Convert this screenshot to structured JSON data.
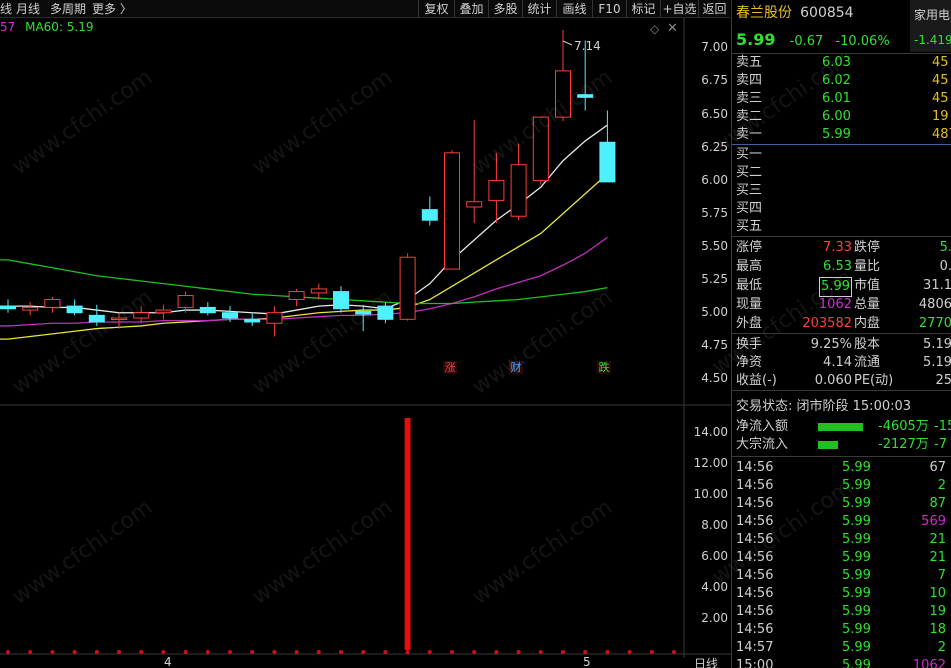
{
  "toolbar": {
    "left": [
      "线",
      "月线",
      "多周期",
      "更多 〉"
    ],
    "buttons": [
      "复权",
      "叠加",
      "多股",
      "统计",
      "画线",
      "F10",
      "标记",
      "+自选",
      "返回"
    ]
  },
  "ma_legend": {
    "prefix": "57",
    "ma60_label": "MA60: 5.19",
    "ma60_color": "#d02ad0"
  },
  "price_axis": [
    "7.00",
    "6.75",
    "6.50",
    "6.25",
    "6.00",
    "5.75",
    "5.50",
    "5.25",
    "5.00",
    "4.75",
    "4.50"
  ],
  "high_annotation": "7.14",
  "events": [
    {
      "label": "涨",
      "color": "#ff4040"
    },
    {
      "label": "财",
      "color": "#4aa8ff"
    },
    {
      "label": "跌",
      "color": "#30e030"
    }
  ],
  "volume_axis": [
    "14.00",
    "12.00",
    "10.00",
    "8.00",
    "6.00",
    "4.00",
    "2.00"
  ],
  "date_axis": [
    "4",
    "5",
    "日线"
  ],
  "colors": {
    "up": "#ff3c3c",
    "down": "#4ff0ff",
    "ma_white": "#e8e8e8",
    "ma_yellow": "#e6e63c",
    "ma_purple": "#c030c0",
    "ma_green": "#20c020",
    "volume_bar": "#e01010",
    "dot": "#d01010"
  },
  "stock": {
    "name": "春兰股份",
    "code": "600854",
    "price": "5.99",
    "change": "-0.67",
    "change_pct": "-10.06%",
    "side_label": "家用电",
    "side_value": "-1.419"
  },
  "order_book": {
    "sell": [
      {
        "label": "卖五",
        "price": "6.03",
        "vol": "45"
      },
      {
        "label": "卖四",
        "price": "6.02",
        "vol": "45"
      },
      {
        "label": "卖三",
        "price": "6.01",
        "vol": "45"
      },
      {
        "label": "卖二",
        "price": "6.00",
        "vol": "19"
      },
      {
        "label": "卖一",
        "price": "5.99",
        "vol": "487"
      }
    ],
    "buy": [
      {
        "label": "买一"
      },
      {
        "label": "买二"
      },
      {
        "label": "买三"
      },
      {
        "label": "买四"
      },
      {
        "label": "买五"
      }
    ]
  },
  "quote_stats": [
    {
      "l1": "涨停",
      "v1": "7.33",
      "c1": "#ff4040",
      "l2": "跌停",
      "v2": "5.",
      "c2": "#30e030"
    },
    {
      "l1": "最高",
      "v1": "6.53",
      "c1": "#30e030",
      "l2": "量比",
      "v2": "0.",
      "c2": "#d0d0d0"
    },
    {
      "l1": "最低",
      "v1": "5.99",
      "c1": "#30e030",
      "l2": "市值",
      "v2": "31.1",
      "c2": "#d0d0d0"
    },
    {
      "l1": "现量",
      "v1": "1062",
      "c1": "#d02ad0",
      "l2": "总量",
      "v2": "4806",
      "c2": "#d0d0d0"
    },
    {
      "l1": "外盘",
      "v1": "203582",
      "c1": "#ff4040",
      "l2": "内盘",
      "v2": "2770",
      "c2": "#30e030"
    }
  ],
  "fundamentals": [
    {
      "l1": "换手",
      "v1": "9.25%",
      "l2": "股本",
      "v2": "5.19"
    },
    {
      "l1": "净资",
      "v1": "4.14",
      "l2": "流通",
      "v2": "5.19"
    },
    {
      "l1": "收益(-)",
      "v1": "0.060",
      "l2": "PE(动)",
      "v2": "25"
    }
  ],
  "trade_status": "交易状态: 闭市阶段 15:00:03",
  "flows": [
    {
      "label": "净流入额",
      "bar_pct": 80,
      "value": "-4605万",
      "extra": "-15"
    },
    {
      "label": "大宗流入",
      "bar_pct": 35,
      "value": "-2127万",
      "extra": "-7"
    }
  ],
  "ticks": [
    {
      "time": "14:56",
      "price": "5.99",
      "vol": "67",
      "vc": "#d0d0d0"
    },
    {
      "time": "14:56",
      "price": "5.99",
      "vol": "2",
      "vc": "#30e030"
    },
    {
      "time": "14:56",
      "price": "5.99",
      "vol": "87",
      "vc": "#30e030"
    },
    {
      "time": "14:56",
      "price": "5.99",
      "vol": "569",
      "vc": "#d02ad0"
    },
    {
      "time": "14:56",
      "price": "5.99",
      "vol": "21",
      "vc": "#30e030"
    },
    {
      "time": "14:56",
      "price": "5.99",
      "vol": "21",
      "vc": "#30e030"
    },
    {
      "time": "14:56",
      "price": "5.99",
      "vol": "7",
      "vc": "#30e030"
    },
    {
      "time": "14:56",
      "price": "5.99",
      "vol": "10",
      "vc": "#30e030"
    },
    {
      "time": "14:56",
      "price": "5.99",
      "vol": "19",
      "vc": "#30e030"
    },
    {
      "time": "14:56",
      "price": "5.99",
      "vol": "18",
      "vc": "#30e030"
    },
    {
      "time": "14:57",
      "price": "5.99",
      "vol": "2",
      "vc": "#30e030"
    },
    {
      "time": "15:00",
      "price": "5.99",
      "vol": "1062",
      "vc": "#d02ad0"
    }
  ],
  "watermark": "www.cfchi.com",
  "chart_data": {
    "type": "candlestick",
    "price_range": [
      4.4,
      7.2
    ],
    "volume_range": [
      0,
      15
    ],
    "candles": [
      {
        "o": 5.05,
        "h": 5.1,
        "l": 5.0,
        "c": 5.03,
        "v": 0.1
      },
      {
        "o": 5.02,
        "h": 5.08,
        "l": 4.98,
        "c": 5.04,
        "v": 0.1
      },
      {
        "o": 5.04,
        "h": 5.12,
        "l": 5.0,
        "c": 5.1,
        "v": 0.1
      },
      {
        "o": 5.05,
        "h": 5.1,
        "l": 4.98,
        "c": 5.0,
        "v": 0.1
      },
      {
        "o": 4.98,
        "h": 5.06,
        "l": 4.9,
        "c": 4.93,
        "v": 0.1
      },
      {
        "o": 4.95,
        "h": 5.0,
        "l": 4.88,
        "c": 4.96,
        "v": 0.1
      },
      {
        "o": 4.96,
        "h": 5.05,
        "l": 4.92,
        "c": 5.0,
        "v": 0.1
      },
      {
        "o": 5.0,
        "h": 5.06,
        "l": 4.95,
        "c": 5.02,
        "v": 0.1
      },
      {
        "o": 5.04,
        "h": 5.16,
        "l": 5.0,
        "c": 5.13,
        "v": 0.1
      },
      {
        "o": 5.04,
        "h": 5.08,
        "l": 4.98,
        "c": 5.0,
        "v": 0.1
      },
      {
        "o": 5.0,
        "h": 5.05,
        "l": 4.93,
        "c": 4.96,
        "v": 0.1
      },
      {
        "o": 4.95,
        "h": 5.0,
        "l": 4.9,
        "c": 4.93,
        "v": 0.1
      },
      {
        "o": 4.92,
        "h": 5.05,
        "l": 4.82,
        "c": 5.0,
        "v": 0.1
      },
      {
        "o": 5.1,
        "h": 5.18,
        "l": 5.05,
        "c": 5.16,
        "v": 0.1
      },
      {
        "o": 5.15,
        "h": 5.22,
        "l": 5.1,
        "c": 5.18,
        "v": 0.1
      },
      {
        "o": 5.16,
        "h": 5.2,
        "l": 5.0,
        "c": 5.03,
        "v": 0.1
      },
      {
        "o": 5.01,
        "h": 5.06,
        "l": 4.86,
        "c": 4.99,
        "v": 0.1
      },
      {
        "o": 5.05,
        "h": 5.08,
        "l": 4.92,
        "c": 4.95,
        "v": 0.1
      },
      {
        "o": 4.95,
        "h": 5.45,
        "l": 4.94,
        "c": 5.42,
        "v": 15.0
      },
      {
        "o": 5.78,
        "h": 5.88,
        "l": 5.66,
        "c": 5.7,
        "v": 0.1
      },
      {
        "o": 5.33,
        "h": 6.23,
        "l": 5.33,
        "c": 6.21,
        "v": 0.1
      },
      {
        "o": 5.8,
        "h": 6.46,
        "l": 5.68,
        "c": 5.84,
        "v": 0.1
      },
      {
        "o": 5.85,
        "h": 6.21,
        "l": 5.68,
        "c": 6.0,
        "v": 0.1
      },
      {
        "o": 5.73,
        "h": 6.28,
        "l": 5.7,
        "c": 6.12,
        "v": 0.1
      },
      {
        "o": 6.0,
        "h": 6.48,
        "l": 5.97,
        "c": 6.48,
        "v": 0.1
      },
      {
        "o": 6.48,
        "h": 7.14,
        "l": 6.45,
        "c": 6.83,
        "v": 0.1
      },
      {
        "o": 6.65,
        "h": 7.06,
        "l": 6.53,
        "c": 6.63,
        "v": 0.1
      },
      {
        "o": 6.29,
        "h": 6.53,
        "l": 5.99,
        "c": 5.99,
        "v": 1.0
      }
    ],
    "ma": [
      {
        "name": "white",
        "values": [
          5.05,
          5.05,
          5.04,
          5.04,
          5.02,
          5.0,
          5.0,
          5.0,
          5.02,
          5.02,
          5.01,
          5.0,
          4.99,
          5.02,
          5.05,
          5.06,
          5.05,
          5.03,
          5.1,
          5.22,
          5.4,
          5.55,
          5.7,
          5.82,
          5.95,
          6.15,
          6.3,
          6.42
        ]
      },
      {
        "name": "yellow",
        "values": [
          4.8,
          4.82,
          4.84,
          4.86,
          4.88,
          4.89,
          4.9,
          4.92,
          4.93,
          4.94,
          4.95,
          4.95,
          4.96,
          4.98,
          5.0,
          5.01,
          5.02,
          5.02,
          5.04,
          5.1,
          5.2,
          5.3,
          5.4,
          5.5,
          5.6,
          5.75,
          5.9,
          6.05
        ]
      },
      {
        "name": "purple",
        "values": [
          4.9,
          4.91,
          4.92,
          4.92,
          4.93,
          4.93,
          4.93,
          4.94,
          4.94,
          4.94,
          4.95,
          4.95,
          4.95,
          4.96,
          4.97,
          4.98,
          4.98,
          4.99,
          5.0,
          5.03,
          5.07,
          5.12,
          5.18,
          5.23,
          5.28,
          5.36,
          5.45,
          5.57
        ]
      },
      {
        "name": "green",
        "values": [
          5.4,
          5.37,
          5.34,
          5.31,
          5.28,
          5.26,
          5.24,
          5.22,
          5.2,
          5.18,
          5.16,
          5.14,
          5.13,
          5.12,
          5.11,
          5.1,
          5.09,
          5.08,
          5.07,
          5.07,
          5.07,
          5.08,
          5.09,
          5.1,
          5.12,
          5.14,
          5.16,
          5.19
        ]
      }
    ]
  }
}
